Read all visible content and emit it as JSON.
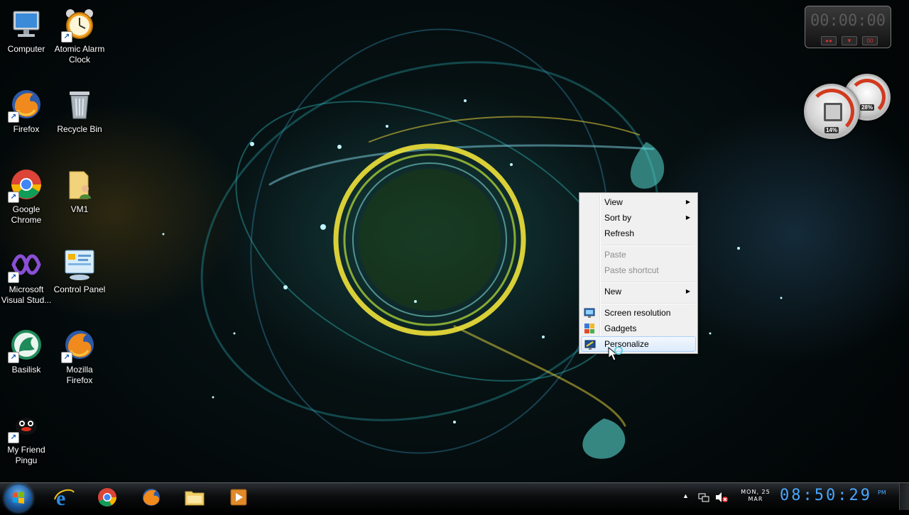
{
  "desktop": {
    "icons": [
      {
        "label": "Computer",
        "icon": "computer-icon"
      },
      {
        "label": "Atomic Alarm Clock",
        "icon": "alarm-clock-icon"
      },
      {
        "label": "Firefox",
        "icon": "firefox-icon"
      },
      {
        "label": "Recycle Bin",
        "icon": "recycle-bin-icon"
      },
      {
        "label": "Google Chrome",
        "icon": "chrome-icon"
      },
      {
        "label": "VM1",
        "icon": "user-folder-icon"
      },
      {
        "label": "Microsoft Visual Stud...",
        "icon": "visual-studio-icon"
      },
      {
        "label": "Control Panel",
        "icon": "control-panel-icon"
      },
      {
        "label": "Basilisk",
        "icon": "basilisk-icon"
      },
      {
        "label": "Mozilla Firefox",
        "icon": "firefox-icon"
      },
      {
        "label": "My Friend Pingu",
        "icon": "pingu-icon"
      }
    ]
  },
  "gadgets": {
    "stopwatch": {
      "time": "00:00:00"
    },
    "cpu_meter": {
      "cpu": "14%",
      "memory": "28%"
    }
  },
  "context_menu": {
    "items": [
      {
        "label": "View",
        "submenu": true,
        "enabled": true
      },
      {
        "label": "Sort by",
        "submenu": true,
        "enabled": true
      },
      {
        "label": "Refresh",
        "enabled": true
      },
      {
        "label": "Paste",
        "enabled": false
      },
      {
        "label": "Paste shortcut",
        "enabled": false
      },
      {
        "label": "New",
        "submenu": true,
        "enabled": true
      },
      {
        "label": "Screen resolution",
        "icon": "screen-resolution-icon",
        "enabled": true
      },
      {
        "label": "Gadgets",
        "icon": "gadgets-icon",
        "enabled": true
      },
      {
        "label": "Personalize",
        "icon": "personalize-icon",
        "enabled": true,
        "highlighted": true
      }
    ]
  },
  "taskbar": {
    "pinned": [
      {
        "icon": "internet-explorer-icon"
      },
      {
        "icon": "chrome-icon"
      },
      {
        "icon": "firefox-icon"
      },
      {
        "icon": "windows-explorer-icon"
      },
      {
        "icon": "media-player-icon"
      }
    ],
    "clock": {
      "date_line1": "MON, 25",
      "date_line2": "MAR",
      "time": "08:50:29",
      "ampm": "PM"
    }
  },
  "colors": {
    "menu_bg": "#f0f0f0",
    "menu_highlight": "#dcebfc",
    "clock_blue": "#4aa6ff",
    "gauge_red": "#d23a1e"
  }
}
